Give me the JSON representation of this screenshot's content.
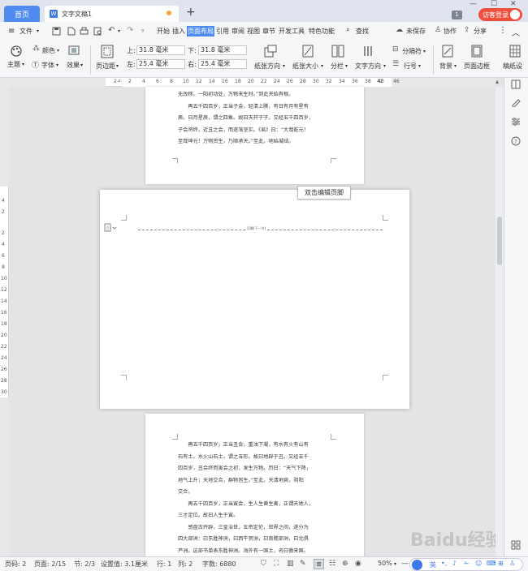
{
  "titlebar": {
    "home_tab": "首页",
    "doc_tab": "文字文稿1",
    "doc_tab_icon": "W",
    "new_tab": "+",
    "page_count_badge": "1",
    "guest_login": "访客登录"
  },
  "menubar": {
    "file": "文件",
    "items": [
      "开始",
      "插入",
      "页面布局",
      "引用",
      "审阅",
      "视图",
      "章节",
      "开发工具",
      "特色功能"
    ],
    "search": "查找",
    "unsaved": "未保存",
    "collab": "协作",
    "share": "分享"
  },
  "ribbon": {
    "theme": "主题",
    "colors": "颜色",
    "fonts": "字体",
    "effects": "效果",
    "margins": "页边距",
    "top_label": "上:",
    "top_value": "31.8 毫米",
    "bottom_label": "下:",
    "bottom_value": "31.8 毫米",
    "left_label": "左:",
    "left_value": "25.4 毫米",
    "right_label": "右:",
    "right_value": "25.4 毫米",
    "orientation": "纸张方向",
    "size": "纸张大小",
    "columns": "分栏",
    "text_direction": "文字方向",
    "breaks": "分隔符",
    "line_numbers": "行号",
    "background": "背景",
    "page_border": "页面边框",
    "paper_manuscript": "稿纸设"
  },
  "rulers": {
    "h": [
      "2",
      "2",
      "4",
      "6",
      "8",
      "10",
      "12",
      "14",
      "16",
      "18",
      "20",
      "22",
      "24",
      "26",
      "28",
      "30",
      "32",
      "34",
      "36",
      "38",
      "40",
      "42",
      "46"
    ],
    "v": [
      "4",
      "2",
      "2",
      "4",
      "6",
      "8",
      "10",
      "12",
      "14",
      "16",
      "18",
      "20",
      "22",
      "24",
      "26",
      "28",
      "30"
    ]
  },
  "page1": {
    "lines": [
      "无改移。一阳初动处，万物未生时。”到此天始有根。",
      "　　再五千四百岁，正当子会，轻清上腾，有日有月有星有",
      "辰。日月星辰，谓之四象。故曰天开于子。又经五千四百岁，",
      "子会将终，近丑之会，而逐渐坚实。《易》曰：“大哉乾元！",
      "至哉坤元！万物资生，乃顺承天。”至此，地始凝结。"
    ]
  },
  "page2": {
    "tooltip": "双击编辑页脚",
    "footer_label": "页脚(下一节)"
  },
  "page3": {
    "lines": [
      "　　再五千四百岁，正当丑会，重浊下凝，有水有火有山有",
      "石有土。水火山石土，谓之五形。故曰地辟于丑。又经五千",
      "四百岁，丑会终而寅会之初，发生万物。历曰：“天气下降，",
      "地气上升；天地交合，群物皆生。”至此，天清地爽，阴阳",
      "交合。",
      "　　再五千四百岁，正当寅会，生人生兽生禽，正谓天地人，",
      "三才定位。故曰人生于寅。",
      "　　感盘古开辟，三皇治世，五帝定伦，世界之间，遂分为",
      "四大部洲：曰东胜神洲，曰西牛贺洲，曰南赡部洲，曰北俱",
      "芦洲。这部书单表东胜神洲。海外有一国土，名曰傲来国。"
    ]
  },
  "status": {
    "page": "页码: 2",
    "pages": "页面: 2/15",
    "section": "节: 2/3",
    "setting": "设置值: 3.1厘米",
    "row": "行: 1",
    "col": "列: 2",
    "words": "字数: 6880",
    "zoom": "50%",
    "ime": "英"
  },
  "watermark": "Baidu经验"
}
